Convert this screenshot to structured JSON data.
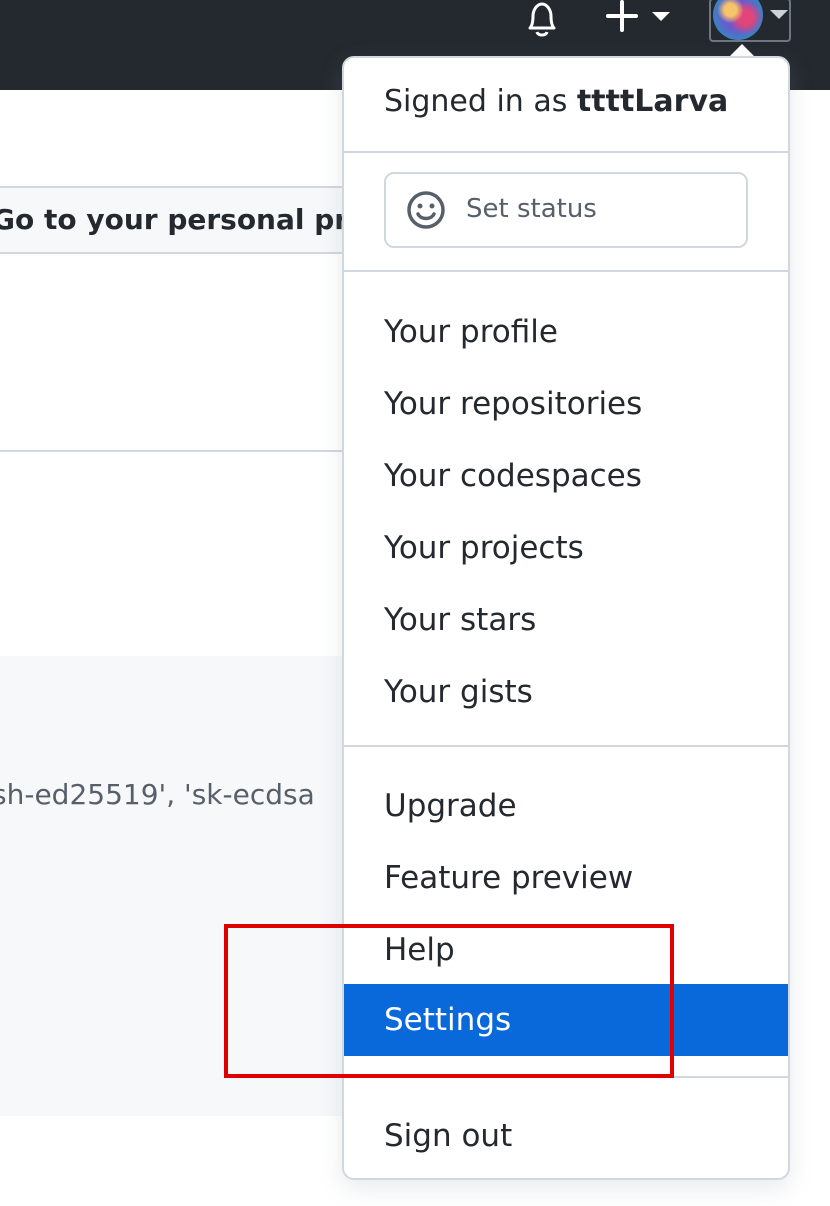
{
  "header": {
    "bell_icon": "bell-icon",
    "plus_icon": "plus-icon",
    "caret_icon": "caret-down-icon",
    "avatar_icon": "avatar"
  },
  "background": {
    "profile_button_label": "Go to your personal profil",
    "code_snippet": "sh-ed25519', 'sk-ecdsa"
  },
  "dropdown": {
    "signed_in_prefix": "Signed in as",
    "username": "ttttLarva",
    "set_status_label": "Set status",
    "group1": [
      "Your profile",
      "Your repositories",
      "Your codespaces",
      "Your projects",
      "Your stars",
      "Your gists"
    ],
    "group2": [
      "Upgrade",
      "Feature preview",
      "Help",
      "Settings"
    ],
    "sign_out": "Sign out",
    "active_item": "Settings",
    "active_color": "#0969da"
  },
  "annotation": {
    "color": "#e00000"
  }
}
